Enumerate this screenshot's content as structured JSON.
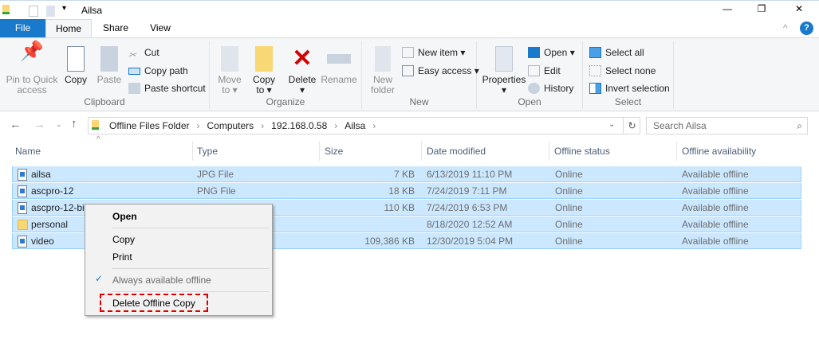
{
  "window": {
    "title": "Ailsa",
    "minimize": "—",
    "restore": "❐",
    "close": "✕"
  },
  "tabs": [
    "File",
    "Home",
    "Share",
    "View"
  ],
  "ribbon": {
    "clipboard": {
      "label": "Clipboard",
      "pin": "Pin to Quick access",
      "copy": "Copy",
      "paste": "Paste",
      "cut": "Cut",
      "copy_path": "Copy path",
      "paste_shortcut": "Paste shortcut"
    },
    "organize": {
      "label": "Organize",
      "move_to": "Move to",
      "copy_to": "Copy to",
      "delete": "Delete",
      "rename": "Rename"
    },
    "new": {
      "label": "New",
      "new_folder": "New folder",
      "new_item": "New item",
      "easy_access": "Easy access"
    },
    "open": {
      "label": "Open",
      "properties": "Properties",
      "open": "Open",
      "edit": "Edit",
      "history": "History"
    },
    "select": {
      "label": "Select",
      "select_all": "Select all",
      "select_none": "Select none",
      "invert": "Invert selection"
    }
  },
  "address": {
    "crumbs": [
      "Offline Files Folder",
      "Computers",
      "192.168.0.58",
      "Ailsa"
    ],
    "search_placeholder": "Search Ailsa"
  },
  "columns": [
    "Name",
    "Type",
    "Size",
    "Date modified",
    "Offline status",
    "Offline availability"
  ],
  "files": [
    {
      "name": "ailsa",
      "type": "JPG File",
      "size": "7 KB",
      "date": "6/13/2019 11:10 PM",
      "status": "Online",
      "availability": "Available offline",
      "icon": "image"
    },
    {
      "name": "ascpro-12",
      "type": "PNG File",
      "size": "18 KB",
      "date": "7/24/2019 7:11 PM",
      "status": "Online",
      "availability": "Available offline",
      "icon": "image"
    },
    {
      "name": "ascpro-12-bi",
      "type": "",
      "size": "110 KB",
      "date": "7/24/2019 6:53 PM",
      "status": "Online",
      "availability": "Available offline",
      "icon": "image"
    },
    {
      "name": "personal",
      "type": "",
      "size": "",
      "date": "8/18/2020 12:52 AM",
      "status": "Online",
      "availability": "Available offline",
      "icon": "folder"
    },
    {
      "name": "video",
      "type": "",
      "size": "109,386 KB",
      "date": "12/30/2019 5:04 PM",
      "status": "Online",
      "availability": "Available offline",
      "icon": "video"
    }
  ],
  "context_menu": {
    "open": "Open",
    "copy": "Copy",
    "print": "Print",
    "always_offline": "Always available offline",
    "delete_offline": "Delete Offline Copy"
  },
  "colors": {
    "accent": "#1979ca",
    "selection": "#cce8ff",
    "highlight": "#e00000"
  }
}
